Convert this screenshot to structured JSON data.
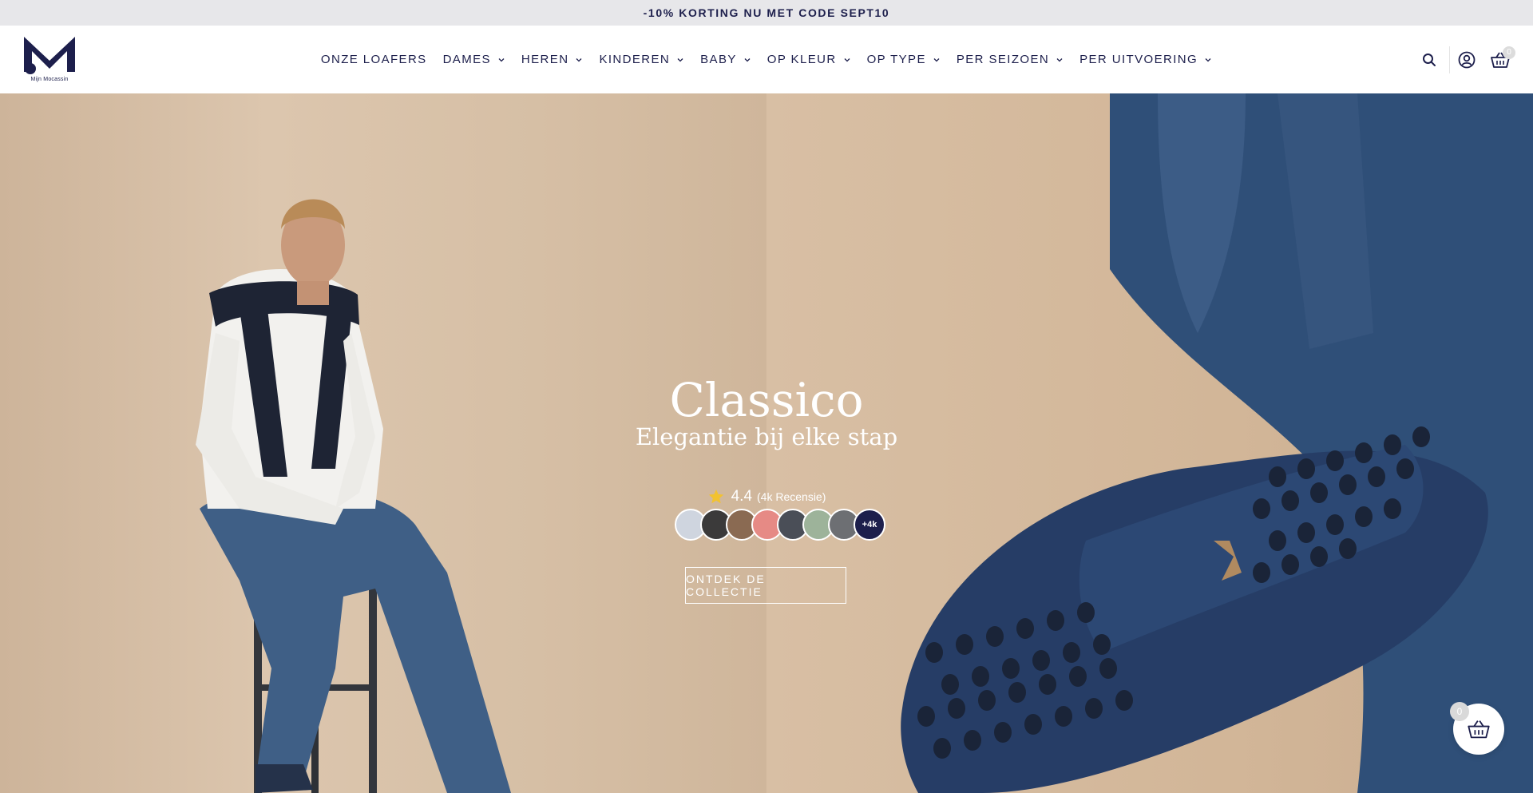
{
  "announcement": {
    "text": "-10% KORTING NU MET CODE SEPT10"
  },
  "brand": {
    "logo_text": "Mijn Mocassin",
    "primary_color": "#1d1f4c"
  },
  "nav": {
    "items": [
      {
        "label": "ONZE LOAFERS",
        "has_dropdown": false
      },
      {
        "label": "DAMES",
        "has_dropdown": true
      },
      {
        "label": "HEREN",
        "has_dropdown": true
      },
      {
        "label": "KINDEREN",
        "has_dropdown": true
      },
      {
        "label": "BABY",
        "has_dropdown": true
      },
      {
        "label": "OP KLEUR",
        "has_dropdown": true
      },
      {
        "label": "OP TYPE",
        "has_dropdown": true
      },
      {
        "label": "PER SEIZOEN",
        "has_dropdown": true
      },
      {
        "label": "PER UITVOERING",
        "has_dropdown": true
      }
    ]
  },
  "header_icons": {
    "search": "search-icon",
    "account": "account-icon",
    "cart": "basket-icon",
    "cart_count": "0"
  },
  "hero": {
    "title": "Classico",
    "subtitle": "Elegantie bij elke stap",
    "rating": {
      "score": "4.4",
      "count_text": "(4k Recensie)",
      "star_color": "#f2c230"
    },
    "avatars_more": "+4k",
    "cta_label": "ONTDEK DE COLLECTIE"
  },
  "floating_cart": {
    "count": "0",
    "icon": "basket-icon"
  }
}
